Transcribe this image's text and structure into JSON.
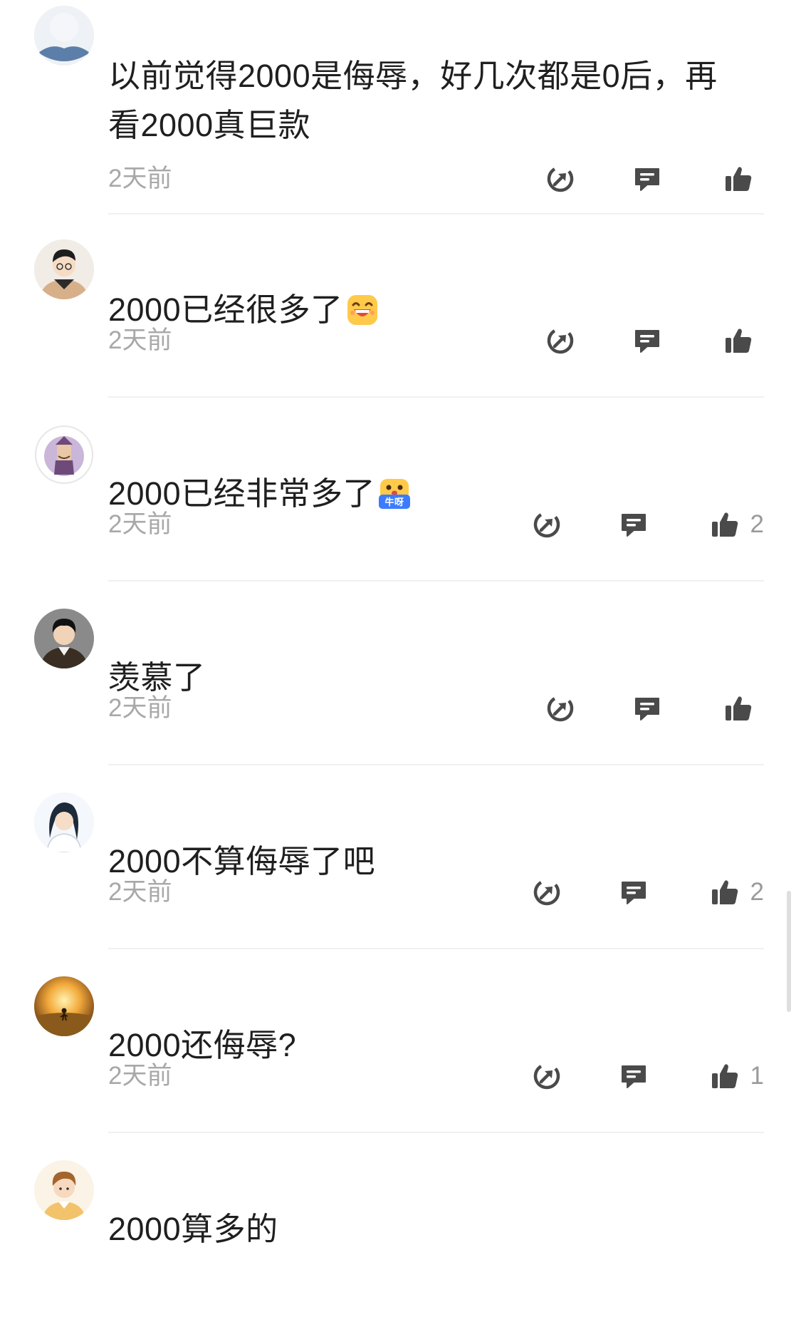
{
  "comments": [
    {
      "username": "",
      "text": "以前觉得2000是侮辱，好几次都是0后，再看2000真巨款",
      "time": "2天前",
      "likes": "",
      "emoji": ""
    },
    {
      "username": "",
      "text": "2000已经很多了",
      "time": "2天前",
      "likes": "",
      "emoji": "grin-emoji"
    },
    {
      "username": "",
      "text": "2000已经非常多了",
      "time": "2天前",
      "likes": "2",
      "emoji": "niu-ya-emoji"
    },
    {
      "username": "",
      "text": "羡慕了",
      "time": "2天前",
      "likes": "",
      "emoji": ""
    },
    {
      "username": "",
      "text": "2000不算侮辱了吧",
      "time": "2天前",
      "likes": "2",
      "emoji": ""
    },
    {
      "username": "",
      "text": "2000还侮辱?",
      "time": "2天前",
      "likes": "1",
      "emoji": ""
    },
    {
      "username": "",
      "text": "2000算多的",
      "time": "",
      "likes": "",
      "emoji": ""
    }
  ],
  "emoji_labels": {
    "niu_ya": "牛呀"
  },
  "icons": {
    "share": "share-icon",
    "reply": "reply-icon",
    "like": "thumbs-up-icon"
  },
  "colors": {
    "text": "#1f1f1f",
    "muted": "#a8a8a8",
    "icon": "#4a4a4a",
    "divider": "#f0f0f0"
  }
}
